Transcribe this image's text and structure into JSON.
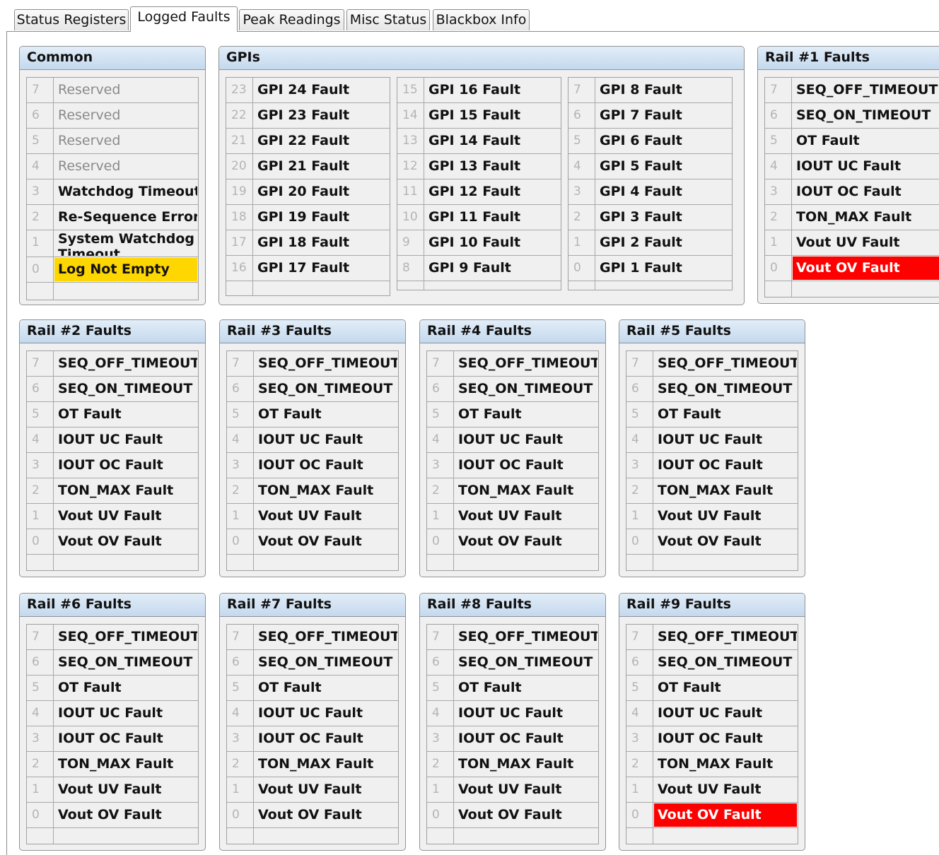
{
  "tabs": [
    "Status Registers",
    "Logged Faults",
    "Peak Readings",
    "Misc Status",
    "Blackbox Info"
  ],
  "active_tab": "Logged Faults",
  "common": {
    "title": "Common",
    "rows": [
      {
        "bit": "7",
        "label": "Reserved",
        "state": "reserved"
      },
      {
        "bit": "6",
        "label": "Reserved",
        "state": "reserved"
      },
      {
        "bit": "5",
        "label": "Reserved",
        "state": "reserved"
      },
      {
        "bit": "4",
        "label": "Reserved",
        "state": "reserved"
      },
      {
        "bit": "3",
        "label": "Watchdog Timeout",
        "state": "normal"
      },
      {
        "bit": "2",
        "label": "Re-Sequence Error",
        "state": "normal"
      },
      {
        "bit": "1",
        "label": "System Watchdog Timeout",
        "state": "normal"
      },
      {
        "bit": "0",
        "label": "Log Not Empty",
        "state": "warning"
      }
    ]
  },
  "gpis": {
    "title": "GPIs",
    "groups": [
      [
        {
          "bit": "23",
          "label": "GPI 24 Fault",
          "state": "normal"
        },
        {
          "bit": "22",
          "label": "GPI 23 Fault",
          "state": "normal"
        },
        {
          "bit": "21",
          "label": "GPI 22 Fault",
          "state": "normal"
        },
        {
          "bit": "20",
          "label": "GPI 21 Fault",
          "state": "normal"
        },
        {
          "bit": "19",
          "label": "GPI 20 Fault",
          "state": "normal"
        },
        {
          "bit": "18",
          "label": "GPI 19 Fault",
          "state": "normal"
        },
        {
          "bit": "17",
          "label": "GPI 18 Fault",
          "state": "normal"
        },
        {
          "bit": "16",
          "label": "GPI 17 Fault",
          "state": "normal"
        }
      ],
      [
        {
          "bit": "15",
          "label": "GPI 16 Fault",
          "state": "normal"
        },
        {
          "bit": "14",
          "label": "GPI 15 Fault",
          "state": "normal"
        },
        {
          "bit": "13",
          "label": "GPI 14 Fault",
          "state": "normal"
        },
        {
          "bit": "12",
          "label": "GPI 13 Fault",
          "state": "normal"
        },
        {
          "bit": "11",
          "label": "GPI 12 Fault",
          "state": "normal"
        },
        {
          "bit": "10",
          "label": "GPI 11 Fault",
          "state": "normal"
        },
        {
          "bit": "9",
          "label": "GPI 10 Fault",
          "state": "normal"
        },
        {
          "bit": "8",
          "label": "GPI 9 Fault",
          "state": "normal"
        }
      ],
      [
        {
          "bit": "7",
          "label": "GPI 8 Fault",
          "state": "normal"
        },
        {
          "bit": "6",
          "label": "GPI 7 Fault",
          "state": "normal"
        },
        {
          "bit": "5",
          "label": "GPI 6 Fault",
          "state": "normal"
        },
        {
          "bit": "4",
          "label": "GPI 5 Fault",
          "state": "normal"
        },
        {
          "bit": "3",
          "label": "GPI 4 Fault",
          "state": "normal"
        },
        {
          "bit": "2",
          "label": "GPI 3 Fault",
          "state": "normal"
        },
        {
          "bit": "1",
          "label": "GPI 2 Fault",
          "state": "normal"
        },
        {
          "bit": "0",
          "label": "GPI 1 Fault",
          "state": "normal"
        }
      ]
    ]
  },
  "rail_fault_labels": [
    "SEQ_OFF_TIMEOUT",
    "SEQ_ON_TIMEOUT",
    "OT Fault",
    "IOUT UC Fault",
    "IOUT OC Fault",
    "TON_MAX Fault",
    "Vout UV Fault",
    "Vout OV Fault"
  ],
  "rail_bits": [
    "7",
    "6",
    "5",
    "4",
    "3",
    "2",
    "1",
    "0"
  ],
  "rails": [
    {
      "title": "Rail #1 Faults",
      "active": [
        7
      ]
    },
    {
      "title": "Rail #2 Faults",
      "active": []
    },
    {
      "title": "Rail #3 Faults",
      "active": []
    },
    {
      "title": "Rail #4 Faults",
      "active": []
    },
    {
      "title": "Rail #5 Faults",
      "active": []
    },
    {
      "title": "Rail #6 Faults",
      "active": []
    },
    {
      "title": "Rail #7 Faults",
      "active": []
    },
    {
      "title": "Rail #8 Faults",
      "active": []
    },
    {
      "title": "Rail #9 Faults",
      "active": [
        7
      ]
    }
  ],
  "colors": {
    "fault_active": "#ff0000",
    "warning": "#ffd700",
    "header_gradient_top": "#e2edf8",
    "header_gradient_bottom": "#c4d9ee"
  }
}
